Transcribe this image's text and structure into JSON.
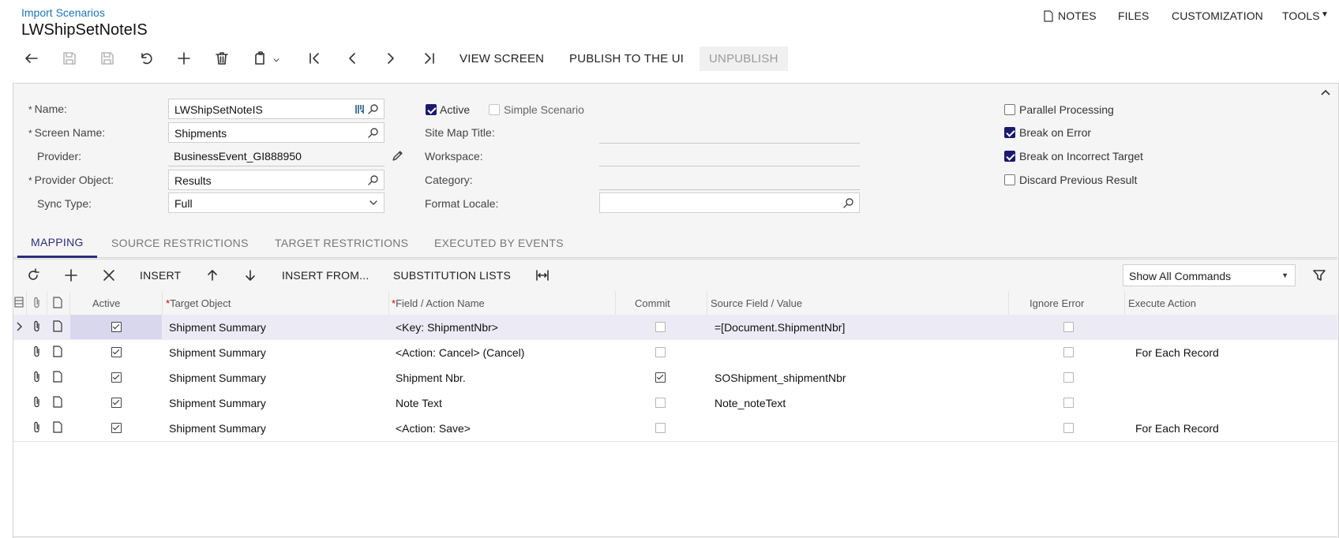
{
  "breadcrumb": "Import Scenarios",
  "page_title": "LWShipSetNoteIS",
  "top_menu": {
    "notes": "NOTES",
    "files": "FILES",
    "customization": "CUSTOMIZATION",
    "tools": "TOOLS"
  },
  "toolbar": {
    "view_screen": "VIEW SCREEN",
    "publish": "PUBLISH TO THE UI",
    "unpublish": "UNPUBLISH"
  },
  "form": {
    "name_label": "Name:",
    "name_value": "LWShipSetNoteIS",
    "screen_label": "Screen Name:",
    "screen_value": "Shipments",
    "provider_label": "Provider:",
    "provider_value": "BusinessEvent_GI888950",
    "provider_object_label": "Provider Object:",
    "provider_object_value": "Results",
    "sync_label": "Sync Type:",
    "sync_value": "Full",
    "active_label": "Active",
    "active_checked": true,
    "simple_label": "Simple Scenario",
    "simple_checked": false,
    "sitemap_label": "Site Map Title:",
    "workspace_label": "Workspace:",
    "category_label": "Category:",
    "format_label": "Format Locale:",
    "parallel_label": "Parallel Processing",
    "parallel_checked": false,
    "break_error_label": "Break on Error",
    "break_error_checked": true,
    "break_target_label": "Break on Incorrect Target",
    "break_target_checked": true,
    "discard_label": "Discard Previous Result",
    "discard_checked": false
  },
  "tabs": [
    "MAPPING",
    "SOURCE RESTRICTIONS",
    "TARGET RESTRICTIONS",
    "EXECUTED BY EVENTS"
  ],
  "grid_toolbar": {
    "insert": "INSERT",
    "insert_from": "INSERT FROM...",
    "substitution": "SUBSTITUTION LISTS",
    "filter_select": "Show All Commands"
  },
  "grid_headers": {
    "active": "Active",
    "target_object": "Target Object",
    "field_action": "Field / Action Name",
    "commit": "Commit",
    "source_field": "Source Field / Value",
    "ignore_error": "Ignore Error",
    "execute_action": "Execute Action"
  },
  "rows": [
    {
      "active": true,
      "target": "Shipment Summary",
      "field": "<Key: ShipmentNbr>",
      "commit": false,
      "source": "=[Document.ShipmentNbr]",
      "ignore": false,
      "execute": ""
    },
    {
      "active": true,
      "target": "Shipment Summary",
      "field": "<Action: Cancel> (Cancel)",
      "commit": false,
      "source": "",
      "ignore": false,
      "execute": "For Each Record"
    },
    {
      "active": true,
      "target": "Shipment Summary",
      "field": "Shipment Nbr.",
      "commit": true,
      "source": "SOShipment_shipmentNbr",
      "ignore": false,
      "execute": ""
    },
    {
      "active": true,
      "target": "Shipment Summary",
      "field": "Note Text",
      "commit": false,
      "source": "Note_noteText",
      "ignore": false,
      "execute": ""
    },
    {
      "active": true,
      "target": "Shipment Summary",
      "field": "<Action: Save>",
      "commit": false,
      "source": "",
      "ignore": false,
      "execute": "For Each Record"
    }
  ]
}
